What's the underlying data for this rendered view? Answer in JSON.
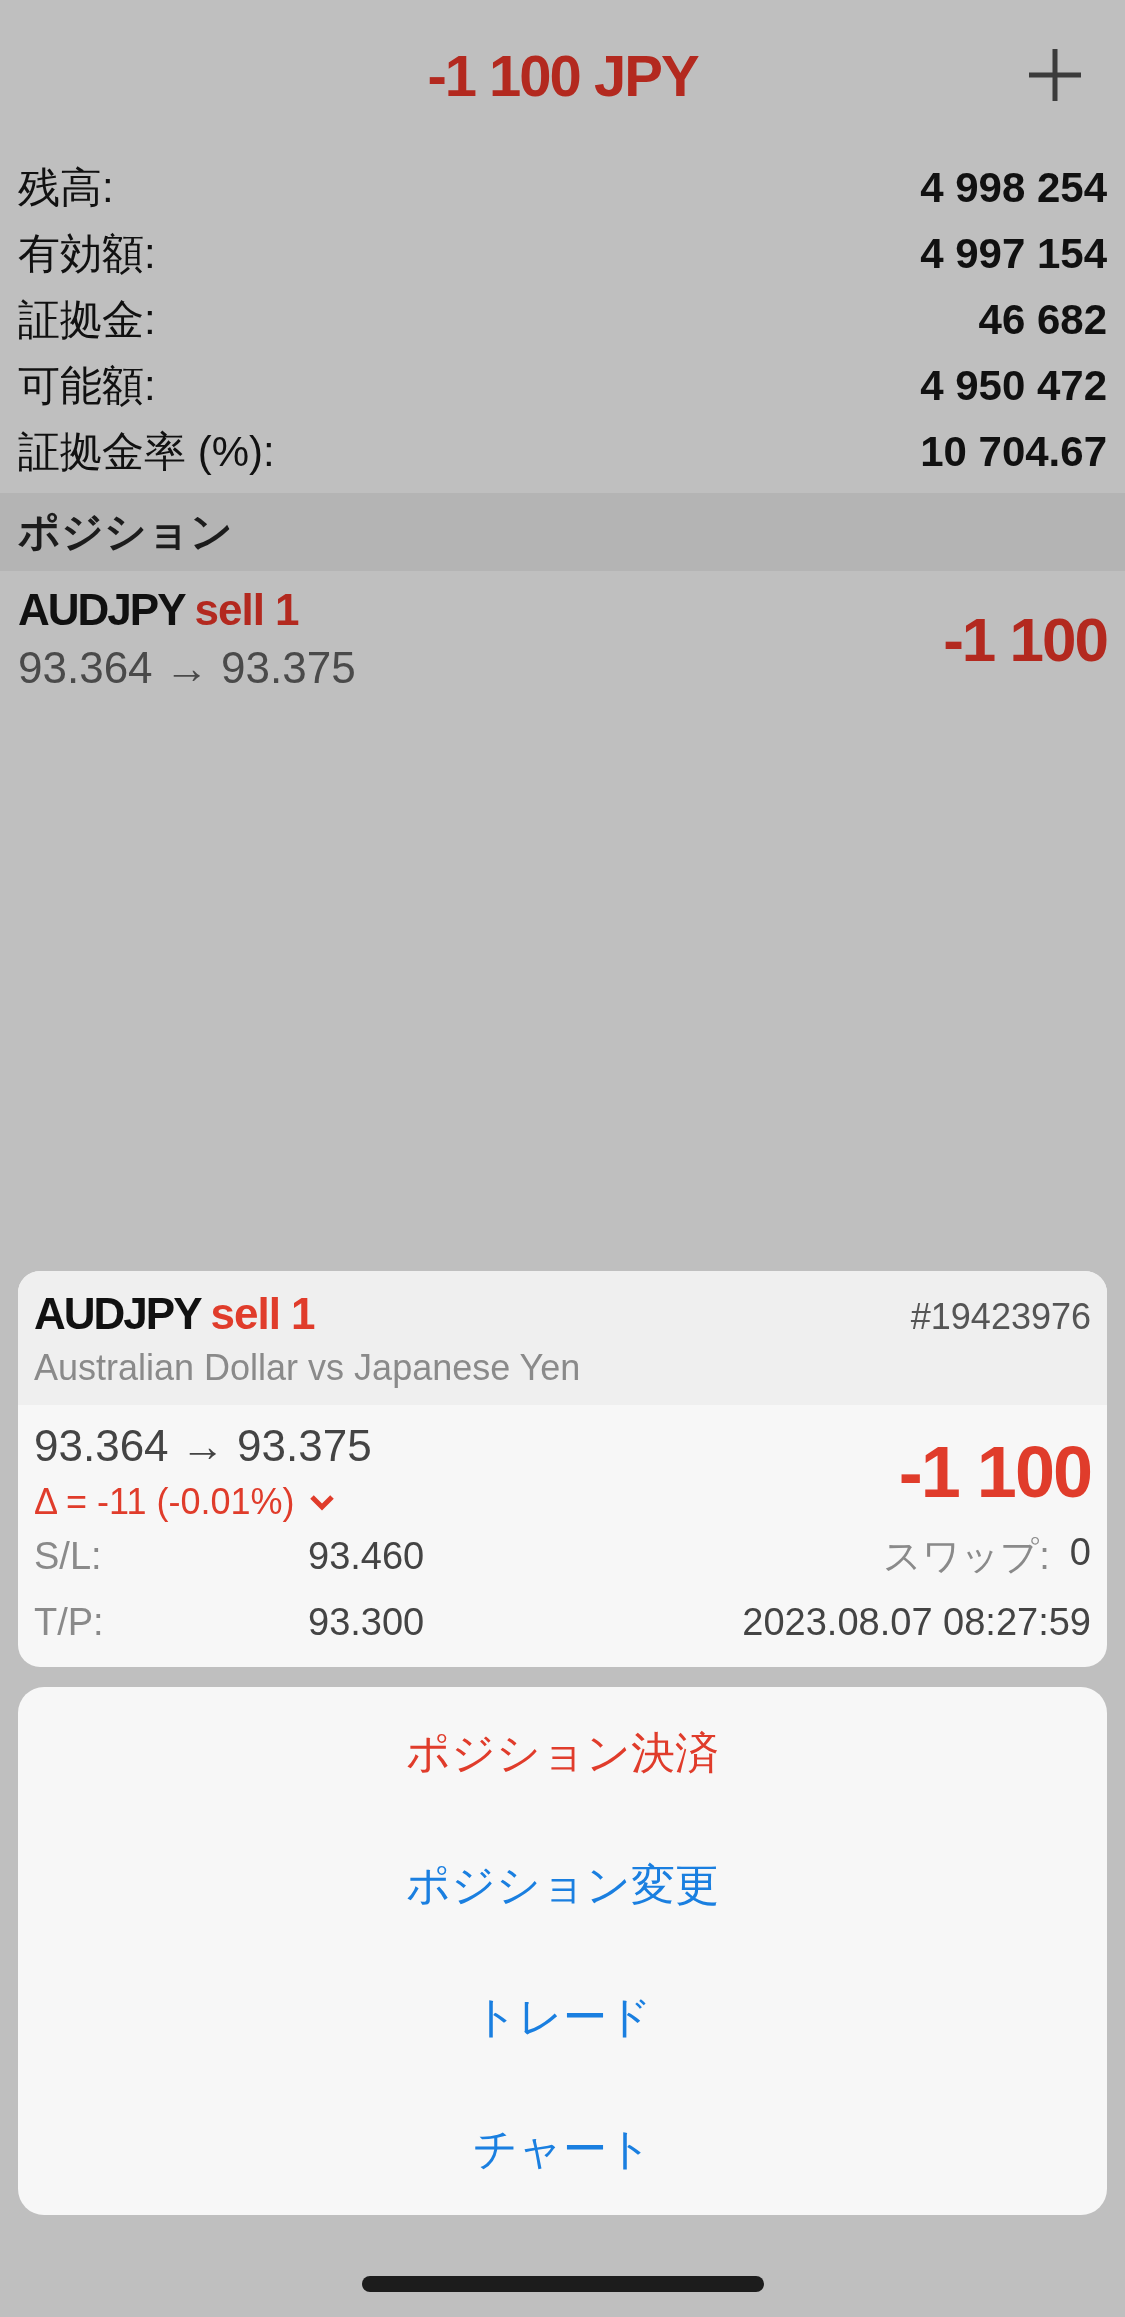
{
  "header": {
    "title": "-1 100 JPY"
  },
  "summary": [
    {
      "label": "残高:",
      "value": "4 998 254"
    },
    {
      "label": "有効額:",
      "value": "4 997 154"
    },
    {
      "label": "証拠金:",
      "value": "46 682"
    },
    {
      "label": "可能額:",
      "value": "4 950 472"
    },
    {
      "label": "証拠金率 (%):",
      "value": "10 704.67"
    }
  ],
  "section": {
    "title": "ポジション"
  },
  "positions": [
    {
      "symbol": "AUDJPY",
      "order": "sell 1",
      "prices": "93.364 → 93.375",
      "profit": "-1 100"
    }
  ],
  "detail": {
    "symbol": "AUDJPY",
    "order": "sell 1",
    "ticket": "#19423976",
    "description": "Australian Dollar vs Japanese Yen",
    "prices": "93.364 → 93.375",
    "delta": "Δ = -11 (-0.01%)",
    "profit": "-1 100",
    "rows": [
      {
        "label": "S/L:",
        "value": "93.460",
        "extra_label": "スワップ:",
        "extra_value": "0"
      },
      {
        "label": "T/P:",
        "value": "93.300",
        "extra_value": "2023.08.07 08:27:59"
      }
    ]
  },
  "actions": [
    {
      "label": "ポジション決済",
      "kind": "destructive"
    },
    {
      "label": "ポジション変更",
      "kind": "default"
    },
    {
      "label": "トレード",
      "kind": "default"
    },
    {
      "label": "チャート",
      "kind": "default"
    }
  ]
}
